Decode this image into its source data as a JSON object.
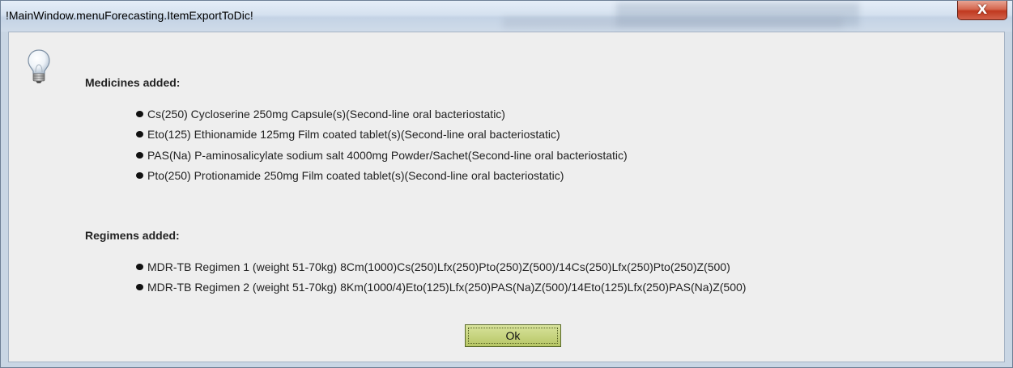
{
  "window": {
    "title": "!MainWindow.menuForecasting.ItemExportToDic!",
    "close_label": "X"
  },
  "icons": {
    "info": "lightbulb-icon",
    "close": "close-icon",
    "bullet": "bullet-dot"
  },
  "colors": {
    "ok_button": "#c4d27a",
    "close_button": "#c9432b",
    "content_bg": "#eeeeee"
  },
  "medicines": {
    "heading": "Medicines added:",
    "items": [
      "Cs(250) Cycloserine 250mg Capsule(s)(Second-line oral bacteriostatic)",
      "Eto(125) Ethionamide 125mg Film coated tablet(s)(Second-line oral bacteriostatic)",
      "PAS(Na) P-aminosalicylate sodium salt 4000mg Powder/Sachet(Second-line oral bacteriostatic)",
      "Pto(250) Protionamide 250mg Film coated tablet(s)(Second-line oral bacteriostatic)"
    ]
  },
  "regimens": {
    "heading": "Regimens added:",
    "items": [
      "MDR-TB Regimen 1 (weight 51-70kg) 8Cm(1000)Cs(250)Lfx(250)Pto(250)Z(500)/14Cs(250)Lfx(250)Pto(250)Z(500)",
      "MDR-TB Regimen 2 (weight 51-70kg) 8Km(1000/4)Eto(125)Lfx(250)PAS(Na)Z(500)/14Eto(125)Lfx(250)PAS(Na)Z(500)"
    ]
  },
  "buttons": {
    "ok_label": "Ok"
  }
}
